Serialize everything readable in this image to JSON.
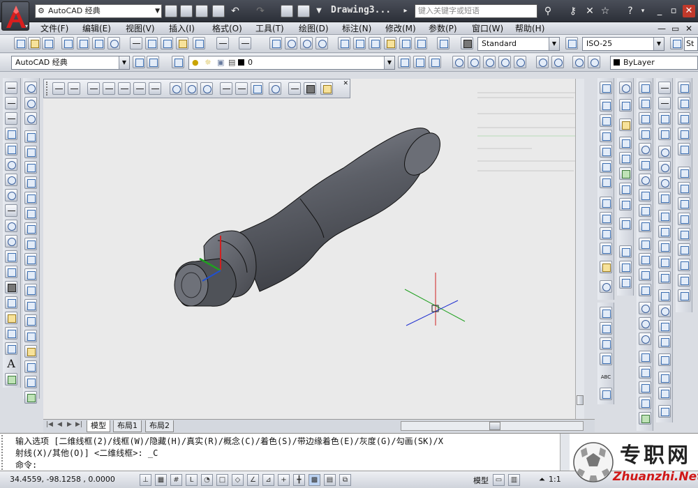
{
  "title_bar": {
    "workspace": "AutoCAD 经典",
    "window_title": "Drawing3...",
    "search_placeholder": "键入关键字或短语",
    "minimize": "_",
    "restore": "▫",
    "close": "✕"
  },
  "menu": [
    "文件(F)",
    "编辑(E)",
    "视图(V)",
    "插入(I)",
    "格式(O)",
    "工具(T)",
    "绘图(D)",
    "标注(N)",
    "修改(M)",
    "参数(P)",
    "窗口(W)",
    "帮助(H)"
  ],
  "menu_window_buttons": {
    "minimize": "—",
    "restore": "▭",
    "close": "✕"
  },
  "styles_toolbar": {
    "text_style": "Standard",
    "dim_style": "ISO-25",
    "table_style": "St"
  },
  "layers_toolbar": {
    "workspace": "AutoCAD 经典",
    "layer": "0",
    "color": "ByLayer"
  },
  "layout_tabs": [
    "模型",
    "布局1",
    "布局2"
  ],
  "command_window": {
    "line1": "输入选项 [二维线框(2)/线框(W)/隐藏(H)/真实(R)/概念(C)/着色(S)/带边缘着色(E)/灰度(G)/勾画(SK)/X",
    "line2": "射线(X)/其他(O)] <二维线框>: _C",
    "prompt": "命令:"
  },
  "status_bar": {
    "coordinates": "34.4559,  -98.1258 , 0.0000",
    "model_label": "模型",
    "scale": "1:1"
  },
  "watermark": {
    "brand": "专职网",
    "url": "Zhuanzhi.Net"
  },
  "colors": {
    "title_bg": "#2f333b",
    "canvas_bg": "#eaeaea",
    "model_body": "#5e6068",
    "ucs_x": "#d02020",
    "ucs_y": "#20a020",
    "ucs_z": "#2030d0"
  }
}
